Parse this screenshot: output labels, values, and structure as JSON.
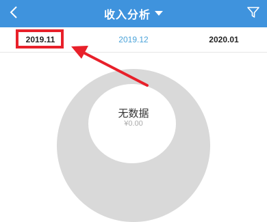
{
  "header": {
    "title": "收入分析",
    "back_icon": "chevron-left-icon",
    "dropdown_icon": "caret-down-icon",
    "filter_icon": "filter-icon",
    "background_color": "#3f93dd"
  },
  "tabs": [
    {
      "label": "2019.11",
      "selected": true
    },
    {
      "label": "2019.12",
      "selected": false
    },
    {
      "label": "2020.01",
      "selected": false
    }
  ],
  "chart": {
    "empty_label": "无数据",
    "amount": "¥0.00",
    "ring_color": "#d9d9d9"
  },
  "annotation": {
    "color": "#e8202a"
  }
}
